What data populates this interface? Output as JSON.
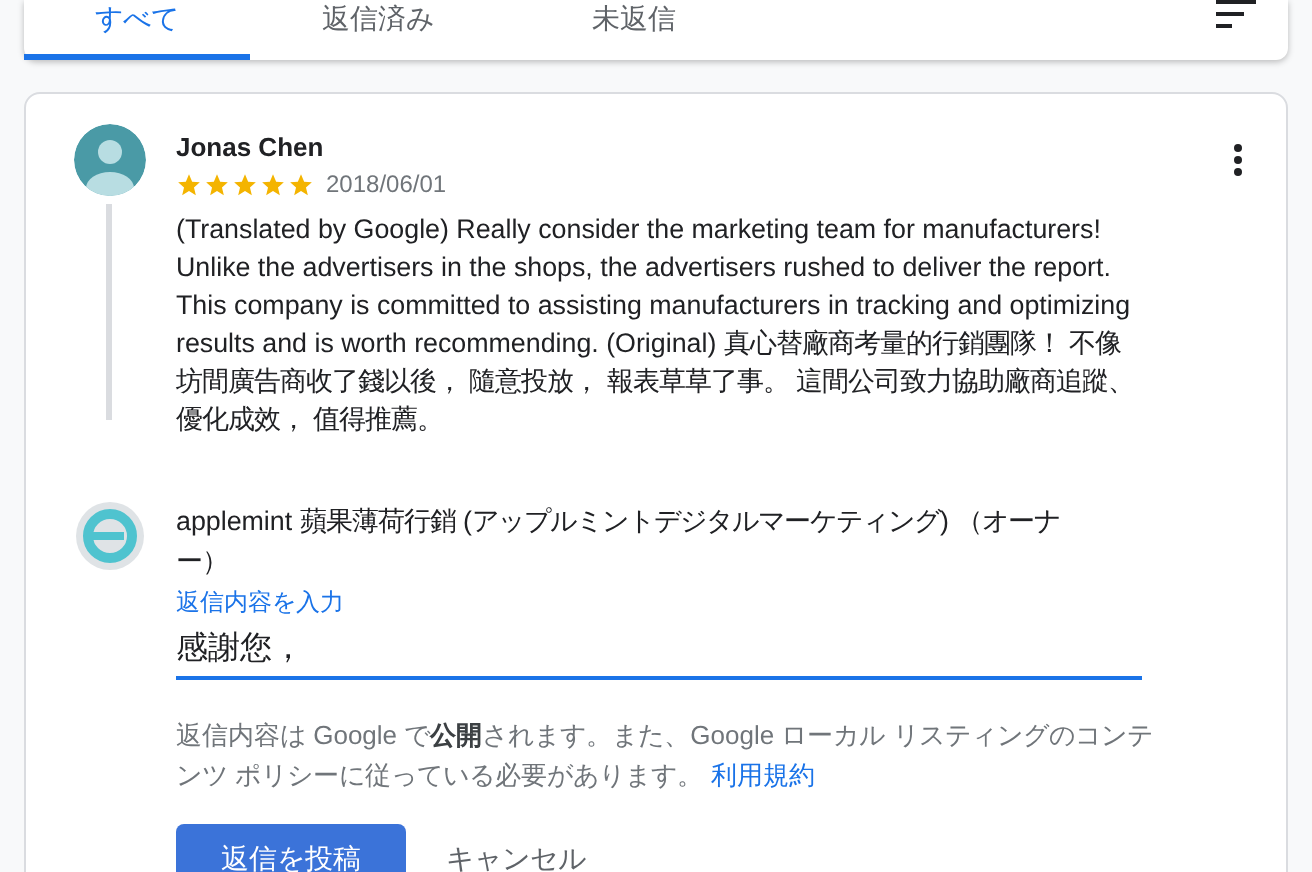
{
  "tabs": [
    {
      "label": "すべて",
      "selected": true
    },
    {
      "label": "返信済み",
      "selected": false
    },
    {
      "label": "未返信",
      "selected": false
    }
  ],
  "review": {
    "author": "Jonas Chen",
    "stars": 5,
    "date": "2018/06/01",
    "text": "(Translated by Google) Really consider the marketing team for manufacturers! Unlike the advertisers in the shops, the advertisers rushed to deliver the report. This company is committed to assisting manufacturers in tracking and optimizing results and is worth recommending. (Original) 真心替廠商考量的行銷團隊！ 不像坊間廣告商收了錢以後， 隨意投放， 報表草草了事。 這間公司致力協助廠商追蹤、優化成效， 值得推薦。"
  },
  "reply": {
    "owner": "applemint 蘋果薄荷行銷 (アップルミントデジタルマーケティング) （オーナー）",
    "field_label": "返信内容を入力",
    "value": "感謝您，",
    "policy": "返信内容は Google で**公開**されます。また、Google ローカル リスティングのコンテンツ ポリシーに従っている必要があります。",
    "policy_link": "利用規約",
    "buttons": [
      {
        "label": "返信を投稿",
        "kind": "primary"
      },
      {
        "label": "キャンセル",
        "kind": "text"
      }
    ]
  }
}
